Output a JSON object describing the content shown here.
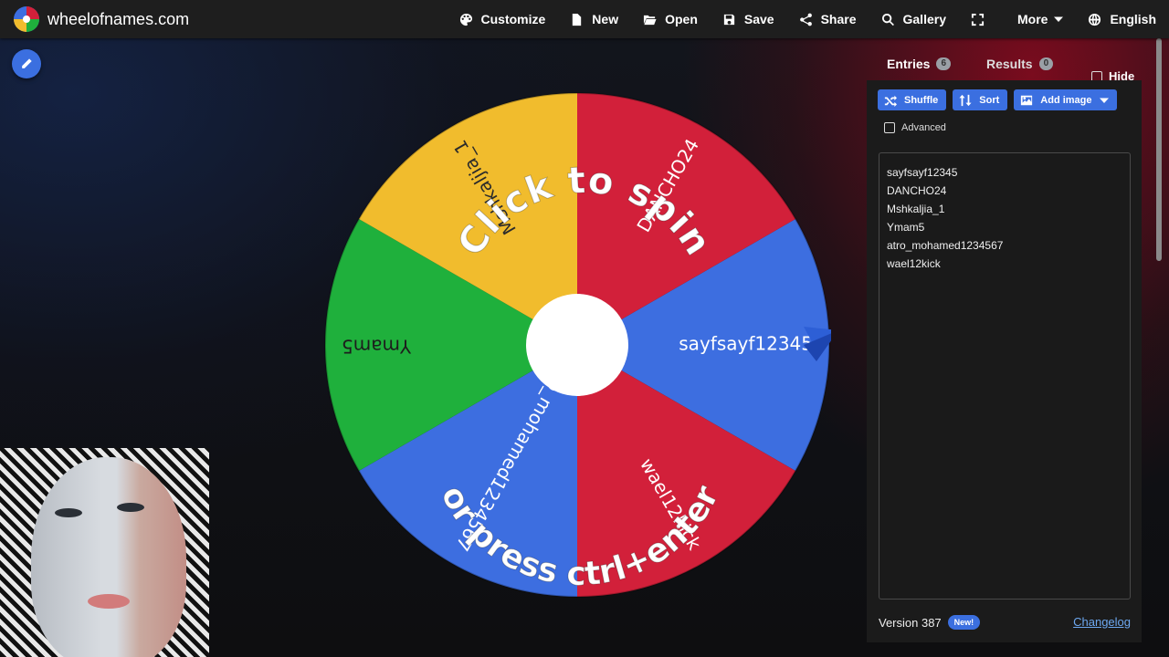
{
  "app": {
    "site_name": "wheelofnames.com"
  },
  "menu": {
    "customize": "Customize",
    "new": "New",
    "open": "Open",
    "save": "Save",
    "share": "Share",
    "gallery": "Gallery",
    "more": "More",
    "language": "English"
  },
  "wheel": {
    "prompt_line1": "Click to spin",
    "prompt_line2": "or press ctrl+enter",
    "segments": [
      {
        "label": "sayfsayf12345",
        "color": "#3d6ee0"
      },
      {
        "label": "wael12kick",
        "color": "#d2203a"
      },
      {
        "label": "atro_mohamed1234567",
        "color": "#3d6ee0"
      },
      {
        "label": "Ymam5",
        "color": "#1fb03c"
      },
      {
        "label": "Mshkaljia_1",
        "color": "#f1bc2d"
      },
      {
        "label": "DANCHO24",
        "color": "#d2203a"
      }
    ]
  },
  "panel": {
    "tab_entries": "Entries",
    "entries_count": "6",
    "tab_results": "Results",
    "results_count": "0",
    "hide_label": "Hide",
    "shuffle": "Shuffle",
    "sort": "Sort",
    "add_image": "Add image",
    "advanced": "Advanced",
    "entries": [
      "sayfsayf12345",
      "DANCHO24",
      "Mshkaljia_1",
      "Ymam5",
      "atro_mohamed1234567",
      "wael12kick"
    ],
    "version": "Version 387",
    "new_badge": "New!",
    "changelog": "Changelog"
  }
}
